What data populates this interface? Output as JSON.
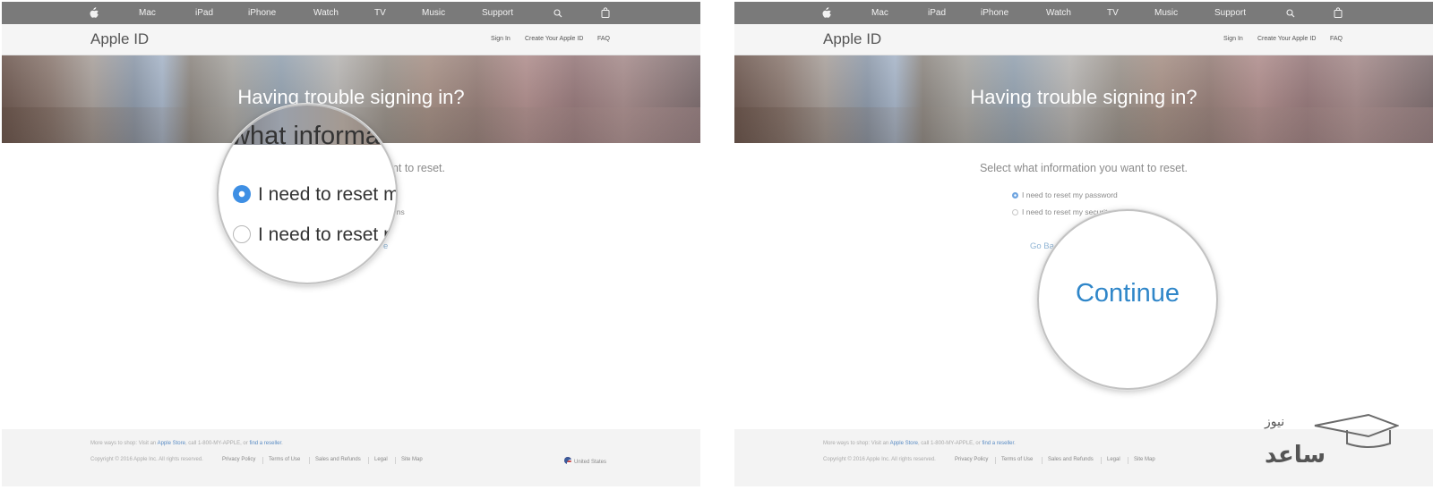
{
  "nav": {
    "items": [
      "Mac",
      "iPad",
      "iPhone",
      "Watch",
      "TV",
      "Music",
      "Support"
    ],
    "icons": {
      "apple": "apple-logo-icon",
      "search": "search-icon",
      "bag": "shopping-bag-icon"
    }
  },
  "subnav": {
    "title": "Apple ID",
    "links": [
      "Sign In",
      "Create Your Apple ID",
      "FAQ"
    ]
  },
  "hero": {
    "title": "Having trouble signing in?"
  },
  "form": {
    "prompt": "Select what information you want to reset.",
    "option_password": "I need to reset my password",
    "option_security": "I need to reset my security questions",
    "back_label": "Go Back",
    "continue_label": "Continue",
    "selected": "option_password"
  },
  "left_visible": {
    "prompt_fragment": "nt to reset.",
    "option_security_fragment": "ons",
    "continue_fragment": "e"
  },
  "right_visible": {
    "option_security_fragment": "I need to reset my security quest"
  },
  "magnifier_left": {
    "heading_fragment": "what informa",
    "option_1_fragment": "I need to reset my",
    "option_2_fragment": "I need to reset m"
  },
  "magnifier_right": {
    "continue_label": "Continue"
  },
  "footer": {
    "shop_prefix": "More ways to shop: Visit an ",
    "apple_store": "Apple Store",
    "shop_middle": ", call 1-800-MY-APPLE, or ",
    "reseller": "find a reseller",
    "shop_suffix": ".",
    "copyright": "Copyright © 2016 Apple Inc. All rights reserved.",
    "legal_links": [
      "Privacy Policy",
      "Terms of Use",
      "Sales and Refunds",
      "Legal",
      "Site Map"
    ],
    "country": "United States"
  },
  "watermark": {
    "line1": "نیوز",
    "line2": "ساعد"
  },
  "colors": {
    "globalnav": "#7a7a7a",
    "link_blue": "#5a8cc4",
    "radio_selected": "#3e8fe4",
    "continue_blue": "#2f86c9"
  }
}
